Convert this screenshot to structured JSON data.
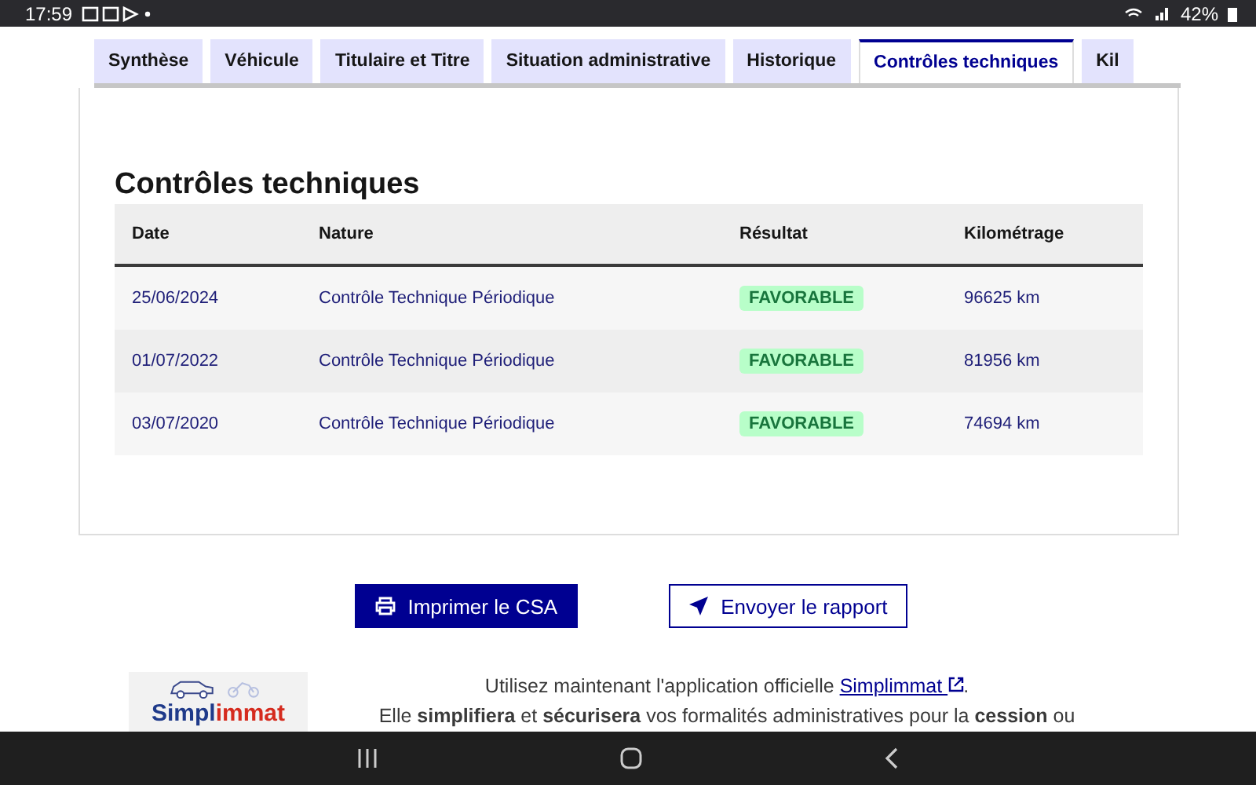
{
  "status_bar": {
    "time": "17:59",
    "battery": "42%"
  },
  "tabs": [
    {
      "label": "Synthèse",
      "selected": false
    },
    {
      "label": "Véhicule",
      "selected": false
    },
    {
      "label": "Titulaire et Titre",
      "selected": false
    },
    {
      "label": "Situation administrative",
      "selected": false
    },
    {
      "label": "Historique",
      "selected": false
    },
    {
      "label": "Contrôles techniques",
      "selected": true
    },
    {
      "label": "Kil",
      "selected": false
    }
  ],
  "section_title": "Contrôles techniques",
  "table": {
    "columns": [
      "Date",
      "Nature",
      "Résultat",
      "Kilométrage"
    ],
    "rows": [
      {
        "date": "25/06/2024",
        "nature": "Contrôle Technique Périodique",
        "result": "FAVORABLE",
        "mileage": "96625 km"
      },
      {
        "date": "01/07/2022",
        "nature": "Contrôle Technique Périodique",
        "result": "FAVORABLE",
        "mileage": "81956 km"
      },
      {
        "date": "03/07/2020",
        "nature": "Contrôle Technique Périodique",
        "result": "FAVORABLE",
        "mileage": "74694 km"
      }
    ]
  },
  "buttons": [
    {
      "label": "Imprimer le CSA",
      "kind": "primary"
    },
    {
      "label": "Envoyer le rapport",
      "kind": "secondary"
    }
  ],
  "promo": {
    "logo_primary": "Simpl",
    "logo_accent": "immat",
    "line_1_before": "Utilisez maintenant l'application officielle",
    "link": "Simplimmat",
    "line_1_after": ".",
    "line_2": "Elle **simplifiera** et **sécurisera** vos formalités administratives pour la **cession** ou"
  }
}
